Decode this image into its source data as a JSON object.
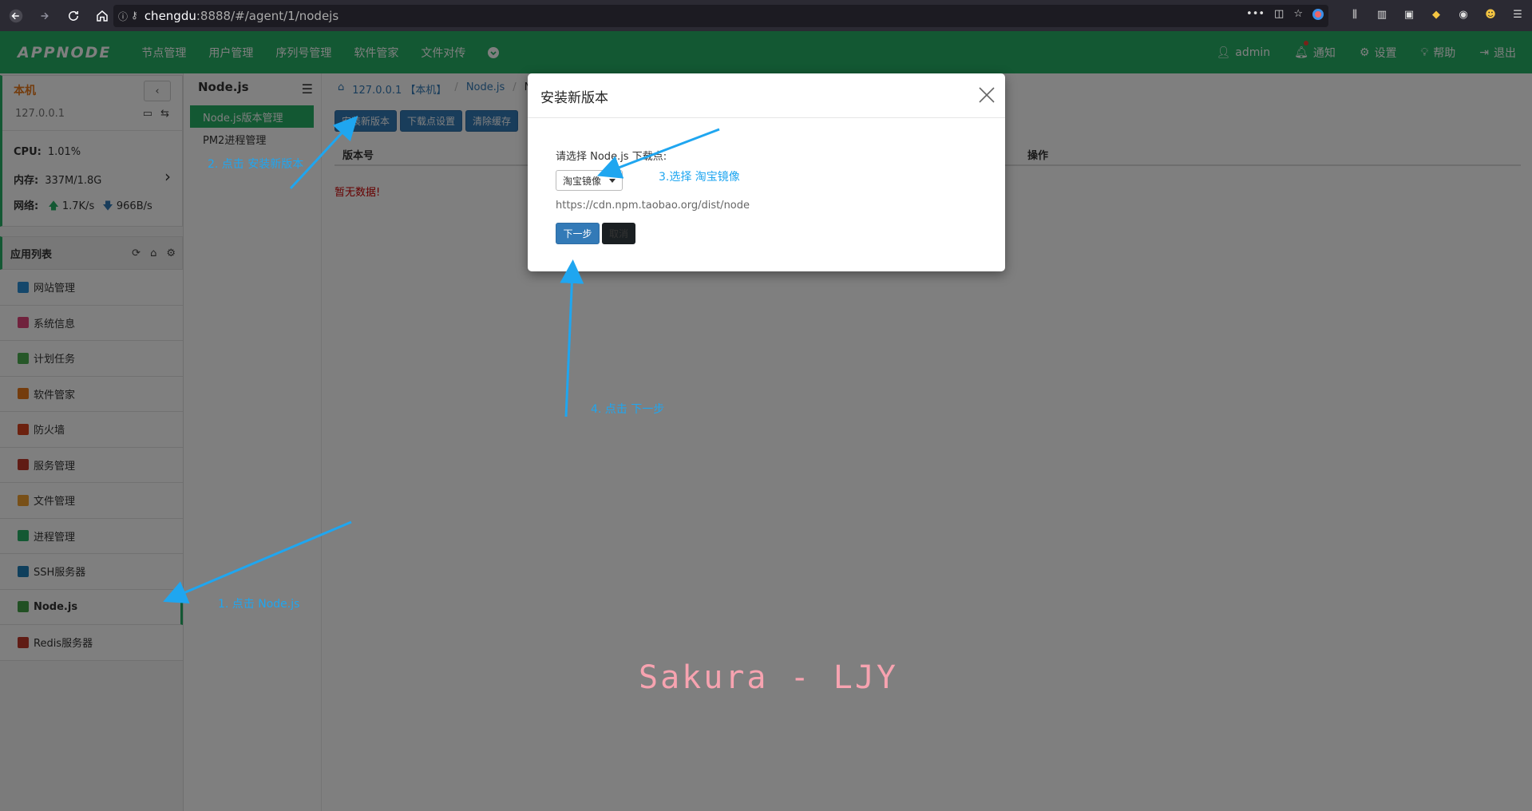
{
  "browser": {
    "url_host": "chengdu",
    "url_rest": ":8888/#/agent/1/nodejs"
  },
  "header": {
    "logo": "APPNODE",
    "nav": [
      "节点管理",
      "用户管理",
      "序列号管理",
      "软件管家",
      "文件对传"
    ],
    "user": "admin",
    "notify": "通知",
    "settings": "设置",
    "help": "帮助",
    "logout": "退出"
  },
  "host": {
    "name": "本机",
    "ip": "127.0.0.1",
    "cpu_label": "CPU:",
    "cpu_value": "1.01%",
    "mem_label": "内存:",
    "mem_value": "337M/1.8G",
    "net_label": "网络:",
    "net_up": "1.7K/s",
    "net_down": "966B/s"
  },
  "apps": {
    "title": "应用列表",
    "items": [
      {
        "label": "网站管理",
        "color": "#2a8fd6"
      },
      {
        "label": "系统信息",
        "color": "#e0457b"
      },
      {
        "label": "计划任务",
        "color": "#4caf50"
      },
      {
        "label": "软件管家",
        "color": "#e8791b"
      },
      {
        "label": "防火墙",
        "color": "#d9431e"
      },
      {
        "label": "服务管理",
        "color": "#c0392b"
      },
      {
        "label": "文件管理",
        "color": "#f0a030"
      },
      {
        "label": "进程管理",
        "color": "#27b067"
      },
      {
        "label": "SSH服务器",
        "color": "#1f7fb8"
      },
      {
        "label": "Node.js",
        "color": "#43a047"
      },
      {
        "label": "Redis服务器",
        "color": "#c0392b"
      }
    ]
  },
  "mid": {
    "title": "Node.js",
    "items": [
      "Node.js版本管理",
      "PM2进程管理"
    ]
  },
  "content": {
    "breadcrumb": [
      "127.0.0.1 【本机】",
      "Node.js",
      "N"
    ],
    "buttons": [
      "安装新版本",
      "下载点设置",
      "清除缓存"
    ],
    "col_version": "版本号",
    "col_op": "操作",
    "no_data": "暂无数据!"
  },
  "modal": {
    "title": "安装新版本",
    "label": "请选择 Node.js 下载点:",
    "selected": "淘宝镜像",
    "url": "https://cdn.npm.taobao.org/dist/node",
    "next": "下一步",
    "cancel": "取消"
  },
  "annotations": {
    "a1": "1. 点击 Node.js",
    "a2": "2. 点击 安装新版本",
    "a3": "3.选择 淘宝镜像",
    "a4": "4. 点击 下一步"
  },
  "watermark": "Sakura - LJY"
}
